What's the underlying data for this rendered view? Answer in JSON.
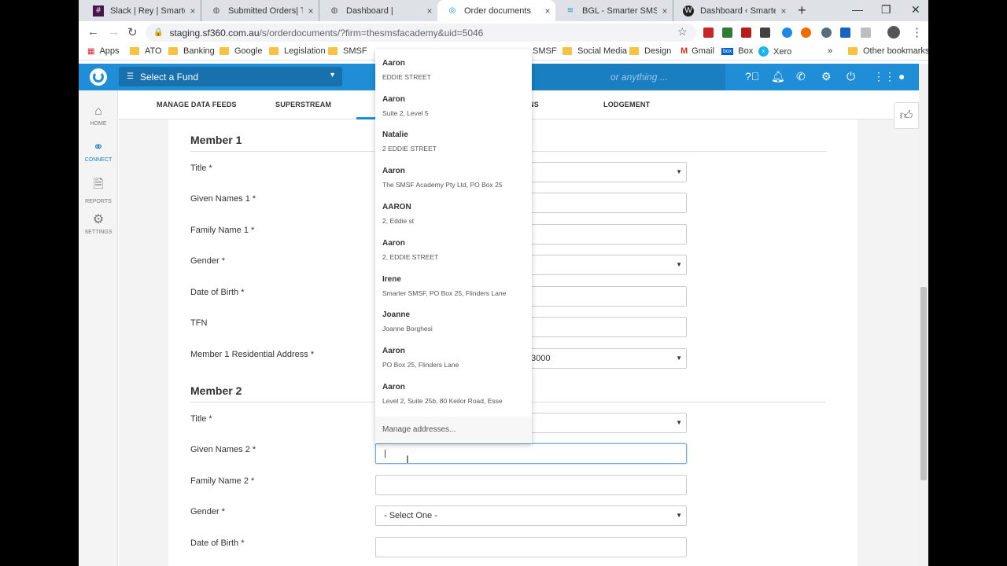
{
  "tabs": [
    {
      "title": "Slack | Rey | Smarter SM",
      "icon": "slack-icon",
      "color": "#4a154b"
    },
    {
      "title": "Submitted Orders| Temp",
      "icon": "globe-icon",
      "color": "#555"
    },
    {
      "title": "Dashboard |",
      "icon": "globe-icon",
      "color": "#555"
    },
    {
      "title": "Order documents",
      "icon": "sf360-icon",
      "color": "#1f8ed6"
    },
    {
      "title": "BGL - Smarter SMSF",
      "icon": "bgl-icon",
      "color": "#1f8ed6"
    },
    {
      "title": "Dashboard ‹ Smarter S",
      "icon": "wordpress-icon",
      "color": "#222"
    }
  ],
  "window": {
    "new_tab": "+",
    "minimize": "—",
    "restore": "❐",
    "close": "✕"
  },
  "url": {
    "host": "staging.sf360.com.au",
    "path": "/s/orderdocuments/?firm=thesmsfacademy&uid=5046"
  },
  "bookmarks": {
    "apps": "Apps",
    "items": [
      "ATO",
      "Banking",
      "Google",
      "Legislation",
      "SMSF",
      "SMSF",
      "Social Media",
      "Design",
      "Gmail",
      "Box",
      "Xero"
    ],
    "more": "»",
    "other": "Other bookmarks"
  },
  "header": {
    "fund_select": "Select a Fund",
    "search_placeholder": "or anything ..."
  },
  "sidebar": [
    {
      "label": "HOME",
      "icon": "home-icon"
    },
    {
      "label": "CONNECT",
      "icon": "connect-icon"
    },
    {
      "label": "REPORTS",
      "icon": "reports-icon"
    },
    {
      "label": "SETTINGS",
      "icon": "gear-icon"
    }
  ],
  "subnav": [
    "MANAGE DATA FEEDS",
    "SUPERSTREAM",
    "NS",
    "LODGEMENT"
  ],
  "member1": {
    "heading": "Member 1",
    "labels": [
      "Title *",
      "Given Names 1 *",
      "Family Name 1 *",
      "Gender *",
      "Date of Birth *",
      "TFN",
      "Member 1 Residential Address *"
    ],
    "address_fragment": "3000"
  },
  "member2": {
    "heading": "Member 2",
    "labels": [
      "Title *",
      "Given Names 2 *",
      "Family Name 2 *",
      "Gender *",
      "Date of Birth *"
    ],
    "gender_value": "- Select One -",
    "given_value": "|"
  },
  "dropdown": {
    "items": [
      {
        "name": "Aaron",
        "address": "EDDIE STREET"
      },
      {
        "name": "Aaron",
        "address": "Suite 2, Level 5"
      },
      {
        "name": "Natalie",
        "address": "2 EDDIE STREET"
      },
      {
        "name": "Aaron",
        "address": "The SMSF Academy Pty Ltd, PO Box 25"
      },
      {
        "name": "AARON",
        "address": "2, Eddie st"
      },
      {
        "name": "Aaron",
        "address": "2, EDDIE STREET"
      },
      {
        "name": "Irene",
        "address": "Smarter SMSF, PO Box 25, Flinders Lane"
      },
      {
        "name": "Joanne",
        "address": "Joanne Borghesi"
      },
      {
        "name": "Aaron",
        "address": "PO Box 25, Flinders Lane"
      },
      {
        "name": "Aaron",
        "address": "Level 2, Suite 25b, 80 Keilor Road, Esse"
      }
    ],
    "manage": "Manage addresses..."
  }
}
